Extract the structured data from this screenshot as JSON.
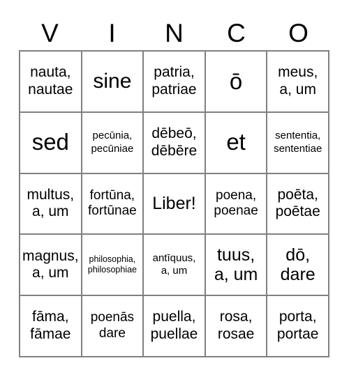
{
  "card": {
    "title": "VINCO",
    "header_letters": [
      "V",
      "I",
      "N",
      "C",
      "O"
    ],
    "grid_size": "5x5",
    "border_color": "#808080",
    "text_color": "#000000",
    "background_color": "#ffffff",
    "rows": [
      [
        {
          "text": "nauta,\nnautae",
          "size": "md"
        },
        {
          "text": "sine",
          "size": "xl"
        },
        {
          "text": "patria,\npatriae",
          "size": "md"
        },
        {
          "text": "ō",
          "size": "xxl"
        },
        {
          "text": "meus,\na, um",
          "size": "md"
        }
      ],
      [
        {
          "text": "sed",
          "size": "xxl"
        },
        {
          "text": "pecūnia,\npecūniae",
          "size": "xs"
        },
        {
          "text": "dēbeō,\ndēbēre",
          "size": "md"
        },
        {
          "text": "et",
          "size": "xxl"
        },
        {
          "text": "sententia,\nsententiae",
          "size": "xs"
        }
      ],
      [
        {
          "text": "multus,\na, um",
          "size": "md"
        },
        {
          "text": "fortūna,\nfortūnae",
          "size": "sm"
        },
        {
          "text": "Liber!",
          "size": "lg"
        },
        {
          "text": "poena,\npoenae",
          "size": "sm"
        },
        {
          "text": "poēta,\npoētae",
          "size": "md"
        }
      ],
      [
        {
          "text": "magnus,\na, um",
          "size": "md"
        },
        {
          "text": "philosophia,\nphilosophiae",
          "size": "xxs"
        },
        {
          "text": "antīquus,\na, um",
          "size": "xs"
        },
        {
          "text": "tuus,\na, um",
          "size": "lg"
        },
        {
          "text": "dō,\ndare",
          "size": "lg"
        }
      ],
      [
        {
          "text": "fāma,\nfāmae",
          "size": "md"
        },
        {
          "text": "poenās\ndare",
          "size": "sm"
        },
        {
          "text": "puella,\npuellae",
          "size": "md"
        },
        {
          "text": "rosa,\nrosae",
          "size": "md"
        },
        {
          "text": "porta,\nportae",
          "size": "md"
        }
      ]
    ]
  }
}
